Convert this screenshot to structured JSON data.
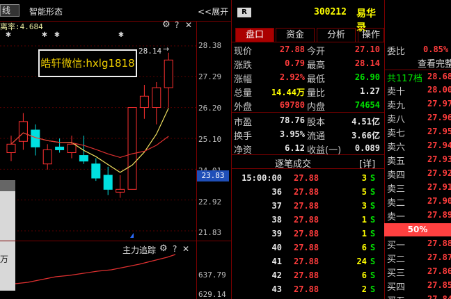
{
  "chart": {
    "period_label": "线",
    "smart_form_label": "智能形态",
    "expand_label": "<<展开",
    "indicator_text": "离率:4.684",
    "watermark_text": "皓轩微信:hxlg1818",
    "high_marker": "28.14",
    "high_arrow": "→",
    "gear_icon": "gear-icon",
    "help": "?",
    "close": "✕",
    "y_labels": [
      "28.38",
      "27.29",
      "26.20",
      "25.10",
      "24.01",
      "22.92",
      "21.83"
    ],
    "current_price_label": "23.83",
    "sub_title": "主力追踪",
    "sub_y_labels": [
      "637.79",
      "629.14"
    ],
    "left_overlay_text": "万"
  },
  "chart_data": {
    "type": "candlestick",
    "candles": [
      {
        "o": 24.6,
        "h": 25.2,
        "l": 24.3,
        "c": 24.9
      },
      {
        "o": 25.0,
        "h": 26.0,
        "l": 24.7,
        "c": 25.7
      },
      {
        "o": 25.4,
        "h": 25.6,
        "l": 24.5,
        "c": 24.8
      },
      {
        "o": 24.2,
        "h": 24.9,
        "l": 24.0,
        "c": 24.7
      },
      {
        "o": 24.8,
        "h": 25.1,
        "l": 24.6,
        "c": 24.7
      },
      {
        "o": 24.6,
        "h": 25.2,
        "l": 24.4,
        "c": 24.9
      },
      {
        "o": 24.5,
        "h": 25.2,
        "l": 24.2,
        "c": 24.3
      },
      {
        "o": 24.2,
        "h": 24.4,
        "l": 23.6,
        "c": 23.7
      },
      {
        "o": 23.8,
        "h": 24.1,
        "l": 23.1,
        "c": 23.3
      },
      {
        "o": 23.2,
        "h": 23.8,
        "l": 23.0,
        "c": 23.3
      },
      {
        "o": 23.3,
        "h": 26.2,
        "l": 23.3,
        "c": 26.2
      },
      {
        "o": 26.2,
        "h": 27.0,
        "l": 25.8,
        "c": 26.6
      },
      {
        "o": 26.2,
        "h": 27.1,
        "l": 25.6,
        "c": 26.9
      },
      {
        "o": 26.9,
        "h": 28.14,
        "l": 26.2,
        "c": 27.88
      }
    ],
    "y_range": [
      21.83,
      28.38
    ]
  },
  "tabs": [
    "盘口",
    "资金",
    "分析",
    "操作"
  ],
  "header": {
    "badge": "R",
    "code": "300212",
    "name": "易华录"
  },
  "quote": {
    "rows": [
      {
        "l1": "现价",
        "v1": "27.88",
        "c1": "red",
        "l2": "今开",
        "v2": "27.10",
        "c2": "red"
      },
      {
        "l1": "涨跌",
        "v1": "0.79",
        "c1": "red",
        "l2": "最高",
        "v2": "28.14",
        "c2": "red"
      },
      {
        "l1": "涨幅",
        "v1": "2.92%",
        "c1": "red",
        "l2": "最低",
        "v2": "26.90",
        "c2": "green"
      },
      {
        "l1": "总量",
        "v1": "14.44万",
        "c1": "yellow",
        "l2": "量比",
        "v2": "1.27",
        "c2": "white"
      },
      {
        "l1": "外盘",
        "v1": "69780",
        "c1": "red",
        "l2": "内盘",
        "v2": "74654",
        "c2": "green"
      },
      {
        "l1": "市盈",
        "v1": "78.76",
        "c1": "white",
        "l2": "股本",
        "v2": "4.51亿",
        "c2": "white"
      },
      {
        "l1": "换手",
        "v1": "3.95%",
        "c1": "white",
        "l2": "流通",
        "v2": "3.66亿",
        "c2": "white"
      },
      {
        "l1": "净资",
        "v1": "6.12",
        "c1": "white",
        "l2": "收益(一)",
        "v2": "0.089",
        "c2": "white"
      }
    ]
  },
  "ticks": {
    "title": "逐笔成交",
    "detail_label": "[详]",
    "rows": [
      {
        "t": "15:00:00",
        "p": "27.88",
        "v": "3",
        "s": "S"
      },
      {
        "t": "36",
        "p": "27.88",
        "v": "5",
        "s": "S"
      },
      {
        "t": "37",
        "p": "27.88",
        "v": "3",
        "s": "S"
      },
      {
        "t": "38",
        "p": "27.88",
        "v": "1",
        "s": "S"
      },
      {
        "t": "39",
        "p": "27.88",
        "v": "1",
        "s": "S"
      },
      {
        "t": "40",
        "p": "27.88",
        "v": "6",
        "s": "S"
      },
      {
        "t": "41",
        "p": "27.88",
        "v": "24",
        "s": "S"
      },
      {
        "t": "42",
        "p": "27.88",
        "v": "6",
        "s": "S"
      },
      {
        "t": "43",
        "p": "27.88",
        "v": "2",
        "s": "S"
      }
    ]
  },
  "depth": {
    "ratio_label": "委比",
    "ratio_value": "0.85%",
    "full_label": "查看完整",
    "count_label": "共117档",
    "count_value": "28.68",
    "mid_label": "50%",
    "sell": [
      {
        "l": "卖十",
        "v": "28.00"
      },
      {
        "l": "卖九",
        "v": "27.97"
      },
      {
        "l": "卖八",
        "v": "27.96"
      },
      {
        "l": "卖七",
        "v": "27.95"
      },
      {
        "l": "卖六",
        "v": "27.94"
      },
      {
        "l": "卖五",
        "v": "27.93"
      },
      {
        "l": "卖四",
        "v": "27.92"
      },
      {
        "l": "卖三",
        "v": "27.91"
      },
      {
        "l": "卖二",
        "v": "27.90"
      },
      {
        "l": "卖一",
        "v": "27.89"
      }
    ],
    "buy": [
      {
        "l": "买一",
        "v": "27.88"
      },
      {
        "l": "买二",
        "v": "27.87"
      },
      {
        "l": "买三",
        "v": "27.86"
      },
      {
        "l": "买四",
        "v": "27.85"
      },
      {
        "l": "买五",
        "v": "27.84"
      }
    ]
  }
}
